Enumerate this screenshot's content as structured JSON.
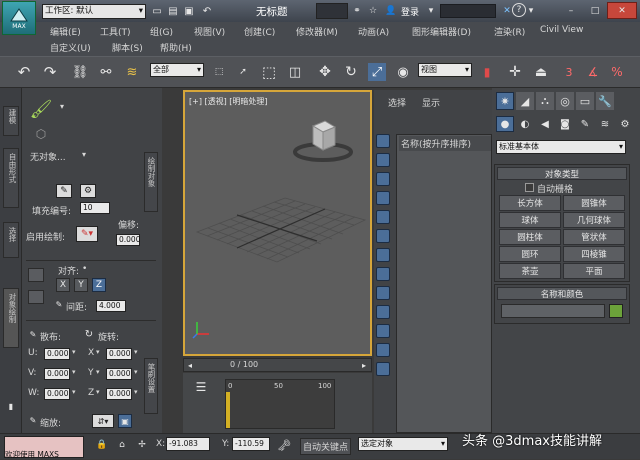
{
  "titlebar": {
    "app_logo": "MAX",
    "workspace_label": "工作区: 默认",
    "document_title": "无标题",
    "login_label": "登录"
  },
  "menu": {
    "row1": [
      "编辑(E)",
      "工具(T)",
      "组(G)",
      "视图(V)",
      "创建(C)",
      "修改器(M)",
      "动画(A)",
      "图形编辑器(D)",
      "渲染(R)",
      "Civil View"
    ],
    "row2": [
      "自定义(U)",
      "脚本(S)",
      "帮助(H)"
    ]
  },
  "toolbar": {
    "selection_filter": "全部",
    "coord_system": "视图"
  },
  "left_panel": {
    "tabs": [
      "建模",
      "自由形式",
      "选择",
      "对象绘制"
    ],
    "no_object": "无对象...",
    "fill_number_label": "填充编号:",
    "fill_number_value": "10",
    "offset_label": "偏移:",
    "offset_value": "0.000",
    "enable_paint_label": "启用绘制:",
    "align_label": "对齐:",
    "axis_x": "X",
    "axis_y": "Y",
    "axis_z": "Z",
    "spacing_label": "间距:",
    "spacing_value": "4.000",
    "scatter_label": "散布:",
    "rotate_label": "旋转:",
    "u_label": "U:",
    "v_label": "V:",
    "w_label": "W:",
    "x_label": "X",
    "y_label": "Y",
    "z_label": "Z",
    "field_zero": "0.000",
    "scale_label": "缩放:",
    "side_tabs": [
      "绘制对象",
      "笔刷设置"
    ]
  },
  "viewport": {
    "label": "[+] [透视] [明暗处理]"
  },
  "timeline": {
    "slider_label": "0 / 100",
    "ticks": [
      "0",
      "50",
      "100"
    ]
  },
  "scene_explorer": {
    "tab_select": "选择",
    "tab_display": "显示",
    "column_header": "名称(按升序排序)"
  },
  "right_panel": {
    "category_dropdown": "标准基本体",
    "object_type_header": "对象类型",
    "autogrid_label": "自动栅格",
    "buttons": [
      "长方体",
      "圆锥体",
      "球体",
      "几何球体",
      "圆柱体",
      "管状体",
      "圆环",
      "四棱锥",
      "茶壶",
      "平面"
    ],
    "name_color_header": "名称和颜色",
    "color_swatch": "#6ca33a"
  },
  "statusbar": {
    "welcome_text": "欢迎使用 MAXS",
    "x_label": "X:",
    "x_value": "-91.083",
    "y_label": "Y:",
    "y_value": "-110.59",
    "auto_key": "自动关键点",
    "selected_object": "选定对象"
  },
  "watermark": "头条 @3dmax技能讲解"
}
